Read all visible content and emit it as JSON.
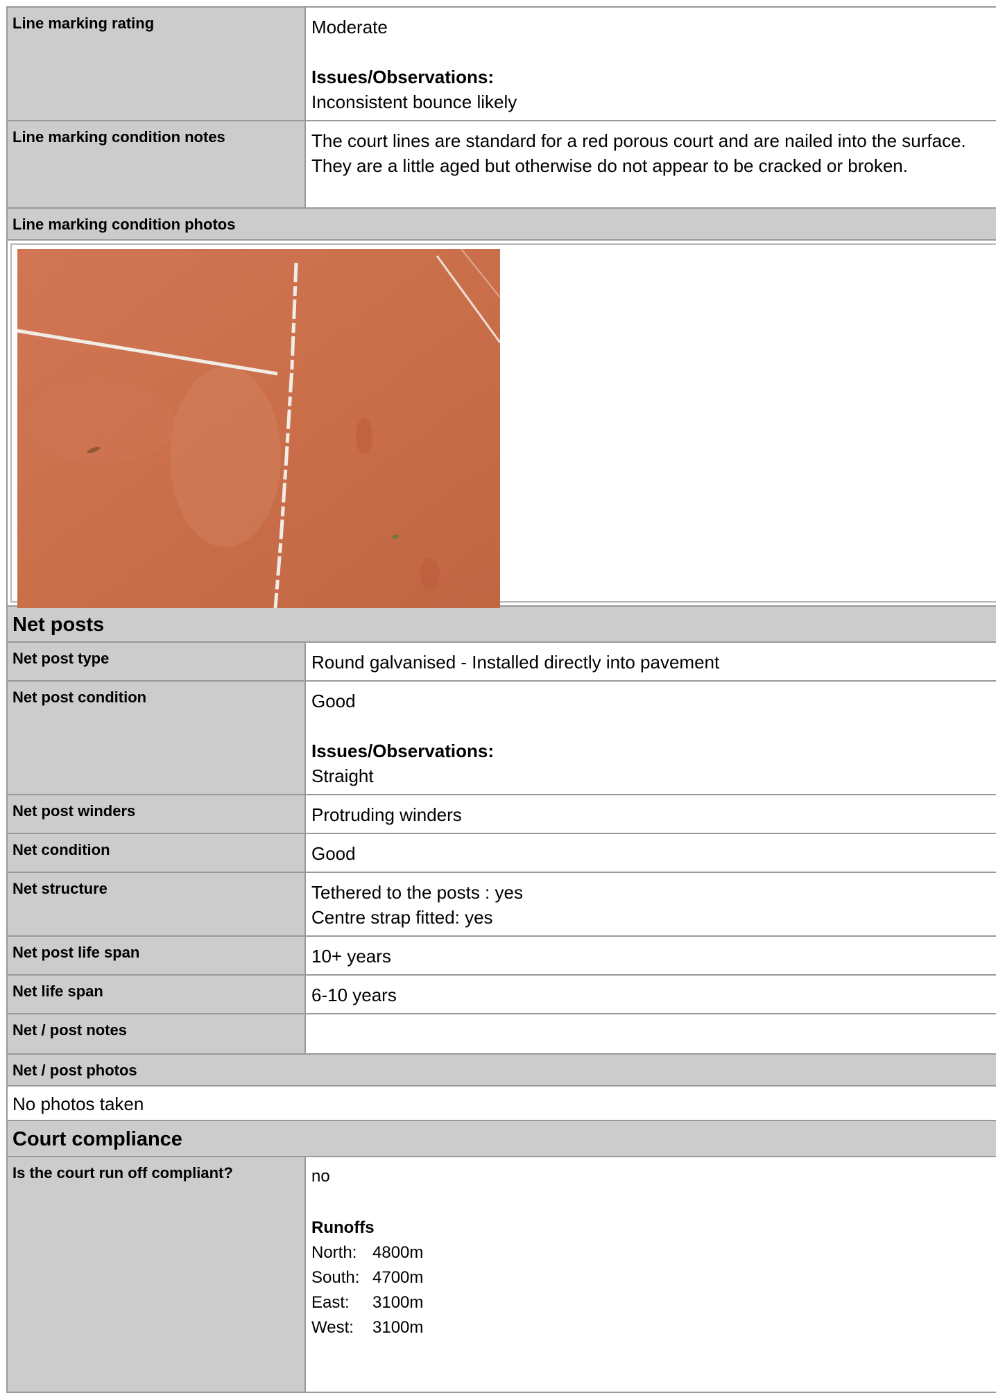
{
  "line_marking": {
    "rating_label": "Line marking rating",
    "rating_value": "Moderate",
    "obs_label": "Issues/Observations:",
    "obs_value": "Inconsistent bounce likely",
    "notes_label": "Line marking condition notes",
    "notes_value": "The court lines are standard for a red porous court and are nailed into the surface. They are a little aged but otherwise do not appear to be cracked or broken.",
    "photos_label": "Line marking condition photos"
  },
  "net_posts": {
    "section_title": "Net posts",
    "type_label": "Net post type",
    "type_value": "Round galvanised - Installed directly into pavement",
    "condition_label": "Net post condition",
    "condition_value": "Good",
    "condition_obs_label": "Issues/Observations:",
    "condition_obs_value": "Straight",
    "winders_label": "Net post winders",
    "winders_value": "Protruding winders",
    "net_condition_label": "Net condition",
    "net_condition_value": "Good",
    "structure_label": "Net structure",
    "structure_line1": "Tethered to the posts : yes",
    "structure_line2": "Centre strap fitted: yes",
    "post_life_label": "Net post life span",
    "post_life_value": "10+ years",
    "net_life_label": "Net life span",
    "net_life_value": "6-10 years",
    "notes_label": "Net / post notes",
    "notes_value": "",
    "photos_label": "Net / post photos",
    "photos_value": "No photos taken"
  },
  "compliance": {
    "section_title": "Court compliance",
    "runoff_label": "Is the court run off compliant?",
    "runoff_value": "no",
    "runoffs_title": "Runoffs",
    "runoffs": [
      {
        "dir": "North:",
        "value": "4800m"
      },
      {
        "dir": "South:",
        "value": "4700m"
      },
      {
        "dir": "East:",
        "value": "3100m"
      },
      {
        "dir": "West:",
        "value": "3100m"
      }
    ]
  },
  "colors": {
    "court_red": "#cc6a42",
    "line_white": "#f2ece6",
    "header_grey": "#cccccc",
    "border_grey": "#999999"
  }
}
